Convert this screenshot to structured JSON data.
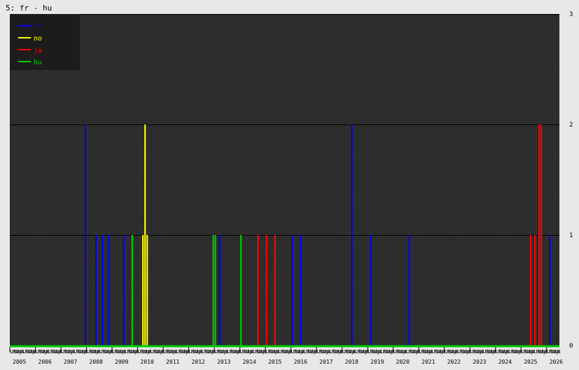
{
  "title": "5: fr - hu",
  "colors": {
    "background": "#e8e8e8",
    "plot": "#2a2a2a",
    "grid": "#000000",
    "baseline": "#00cc00",
    "text": "#000000"
  },
  "chart_data": {
    "type": "bar",
    "title": "5: fr - hu",
    "xlabel": "",
    "ylabel": "",
    "ylim": [
      0,
      3
    ],
    "y_ticks": [
      0,
      1,
      2,
      3
    ],
    "grid": true,
    "legend_position": "top-left",
    "x_range": [
      "2005-01",
      "2026-06"
    ],
    "year_labels": [
      "2005",
      "2006",
      "2007",
      "2008",
      "2009",
      "2010",
      "2011",
      "2012",
      "2013",
      "2014",
      "2015",
      "2016",
      "2017",
      "2018",
      "2019",
      "2020",
      "2021",
      "2022",
      "2023",
      "2024",
      "2025",
      "2026"
    ],
    "month_label_cycle": [
      "Li",
      "Po",
      "St",
      "Vy",
      "Ut",
      "i"
    ],
    "series": [
      {
        "name": "fr",
        "color": "#0000ff",
        "points": [
          {
            "x": "2007-12",
            "y": 2
          },
          {
            "x": "2008-05",
            "y": 1
          },
          {
            "x": "2008-08",
            "y": 1
          },
          {
            "x": "2008-11",
            "y": 1
          },
          {
            "x": "2009-06",
            "y": 1
          },
          {
            "x": "2013-03",
            "y": 1
          },
          {
            "x": "2016-01",
            "y": 1
          },
          {
            "x": "2016-05",
            "y": 1
          },
          {
            "x": "2018-05",
            "y": 2
          },
          {
            "x": "2019-02",
            "y": 1
          },
          {
            "x": "2020-08",
            "y": 1
          },
          {
            "x": "2026-02",
            "y": 1
          }
        ]
      },
      {
        "name": "no",
        "color": "#ffff00",
        "points": [
          {
            "x": "2010-03",
            "y": 1
          },
          {
            "x": "2010-04",
            "y": 2
          },
          {
            "x": "2010-05",
            "y": 1
          }
        ]
      },
      {
        "name": "ja",
        "color": "#ff0000",
        "points": [
          {
            "x": "2014-09",
            "y": 1
          },
          {
            "x": "2015-01",
            "y": 1
          },
          {
            "x": "2015-05",
            "y": 1
          },
          {
            "x": "2025-05",
            "y": 1
          },
          {
            "x": "2025-07",
            "y": 1
          },
          {
            "x": "2025-09",
            "y": 2
          },
          {
            "x": "2025-10",
            "y": 2
          }
        ]
      },
      {
        "name": "hu",
        "color": "#00cc00",
        "points": [
          {
            "x": "2009-10",
            "y": 1
          },
          {
            "x": "2012-12",
            "y": 1
          },
          {
            "x": "2013-01",
            "y": 1
          },
          {
            "x": "2014-01",
            "y": 1
          }
        ]
      }
    ]
  }
}
